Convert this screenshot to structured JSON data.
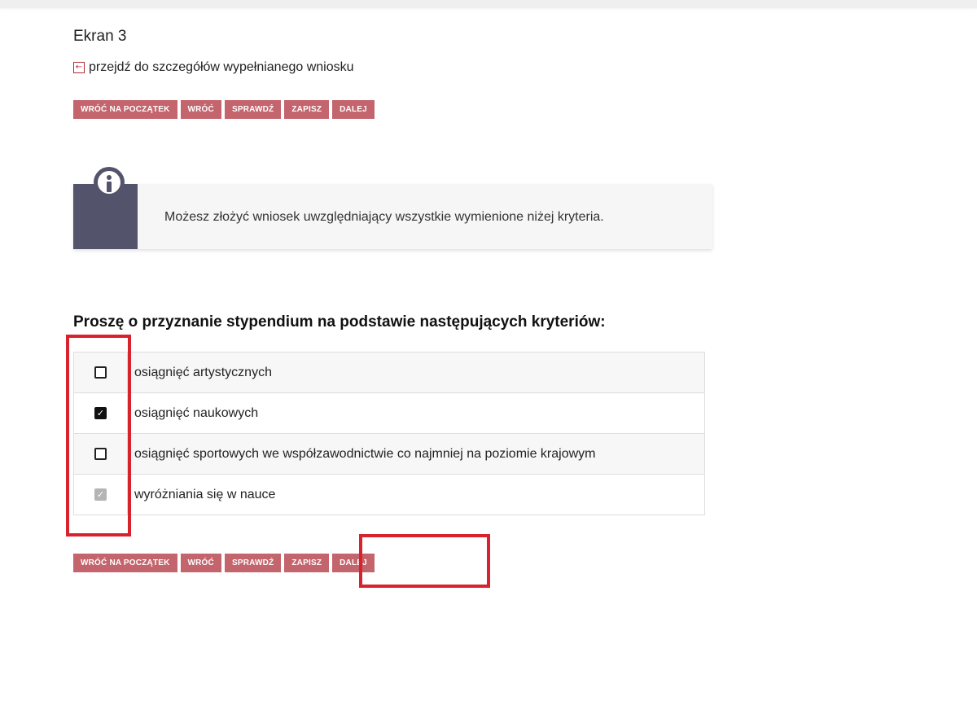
{
  "page": {
    "title": "Ekran 3",
    "back_link": {
      "icon": "arrow-left-box-icon",
      "label": "przejdź do szczegółów wypełnianego wniosku"
    }
  },
  "nav_buttons": [
    "WRÓĆ NA POCZĄTEK",
    "WRÓĆ",
    "SPRAWDŹ",
    "ZAPISZ",
    "DALEJ"
  ],
  "info": {
    "icon": "info-icon",
    "message": "Możesz złożyć wniosek uwzględniający wszystkie wymienione niżej kryteria."
  },
  "criteria": {
    "heading": "Proszę o przyznanie stypendium na podstawie następujących kryteriów:",
    "items": [
      {
        "label": "osiągnięć artystycznych",
        "checked": false,
        "disabled": false
      },
      {
        "label": "osiągnięć naukowych",
        "checked": true,
        "disabled": false
      },
      {
        "label": "osiągnięć sportowych we współzawodnictwie co najmniej na poziomie krajowym",
        "checked": false,
        "disabled": false
      },
      {
        "label": "wyróżniania się w nauce",
        "checked": true,
        "disabled": true
      }
    ]
  },
  "colors": {
    "button_bg": "#c4646c",
    "info_panel": "#54536c",
    "annotation": "#d8232f"
  }
}
